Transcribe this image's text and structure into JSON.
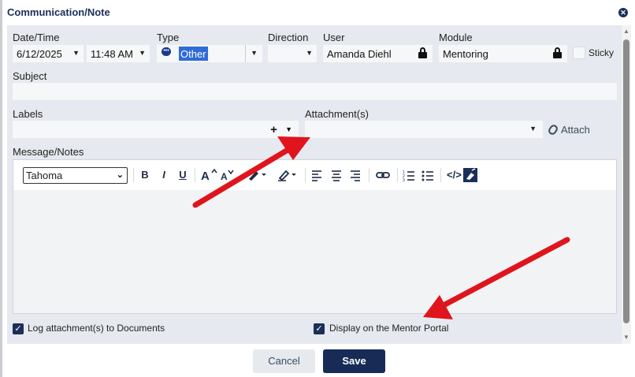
{
  "dialog": {
    "title": "Communication/Note",
    "close_icon": "close-icon"
  },
  "form": {
    "date_time_label": "Date/Time",
    "date_value": "6/12/2025",
    "time_value": "11:48 AM",
    "type_label": "Type",
    "type_icon": "chat-bubble-icon",
    "type_value": "Other",
    "direction_label": "Direction",
    "direction_value": "",
    "user_label": "User",
    "user_value": "Amanda Diehl",
    "module_label": "Module",
    "module_value": "Mentoring",
    "sticky_label": "Sticky",
    "subject_label": "Subject",
    "subject_value": "",
    "labels_label": "Labels",
    "labels_add": "+",
    "attachments_label": "Attachment(s)",
    "attach_label": "Attach",
    "message_label": "Message/Notes",
    "font_value": "Tahoma",
    "message_value": "",
    "log_attachments_label": "Log attachment(s) to Documents",
    "log_attachments_checked": true,
    "display_portal_label": "Display on the Mentor Portal",
    "display_portal_checked": true
  },
  "toolbar_buttons": {
    "bold": "B",
    "italic": "I",
    "underline": "U"
  },
  "footer": {
    "cancel_label": "Cancel",
    "save_label": "Save"
  },
  "colors": {
    "accent": "#162c57",
    "panel": "#e6e9ef",
    "selection": "#2f6bd8",
    "annotation_arrow": "#e0141c"
  }
}
